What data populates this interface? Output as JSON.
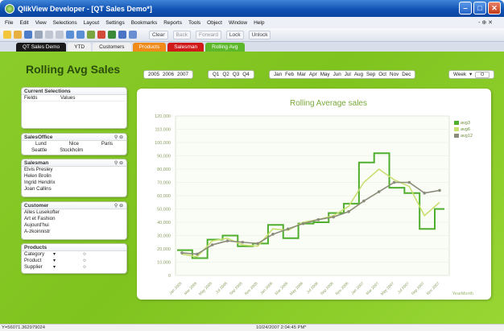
{
  "window": {
    "title": "QlikView Developer - [QT Sales Demo*]"
  },
  "menu": {
    "items": [
      "File",
      "Edit",
      "View",
      "Selections",
      "Layout",
      "Settings",
      "Bookmarks",
      "Reports",
      "Tools",
      "Object",
      "Window",
      "Help"
    ],
    "right_glyph": "- ⊕ ✕"
  },
  "toolbar": {
    "clear": "Clear",
    "back": "Back",
    "forward": "Forward",
    "lock": "Lock",
    "unlock": "Unlock"
  },
  "tabs": [
    {
      "label": "QT Sales Demo",
      "color": "#1a1a1a"
    },
    {
      "label": "YTD",
      "color": "#f0f0f0"
    },
    {
      "label": "Customers",
      "color": "#f0f0f0"
    },
    {
      "label": "Products",
      "color": "#f08a1a"
    },
    {
      "label": "Salesman",
      "color": "#d01a1a"
    },
    {
      "label": "Rolling Avg",
      "color": "#5cb82a"
    }
  ],
  "page": {
    "title": "Rolling Avg Sales"
  },
  "filters": {
    "years": [
      "2005",
      "2006",
      "2007"
    ],
    "quarters": [
      "Q1",
      "Q2",
      "Q3",
      "Q4"
    ],
    "months": [
      "Jan",
      "Feb",
      "Mar",
      "Apr",
      "May",
      "Jun",
      "Jul",
      "Aug",
      "Sep",
      "Oct",
      "Nov",
      "Dec"
    ],
    "week_label": "Week",
    "week_value": "O"
  },
  "current_selections": {
    "title": "Current Selections",
    "col_fields": "Fields",
    "col_values": "Values"
  },
  "sales_office": {
    "title": "SalesOffice",
    "items": [
      "Lund",
      "Nice",
      "Paris",
      "Seattle",
      "Stockholm"
    ]
  },
  "salesman": {
    "title": "Salesman",
    "items": [
      "Elvis Presley",
      "Helen Brolin",
      "Ingrid Hendrix",
      "Joan Callins"
    ]
  },
  "customer": {
    "title": "Customer",
    "items": [
      "Alles Lusekofter",
      "Art et Fashion",
      "Aujourd'hui",
      "A-zkoinnistr"
    ]
  },
  "products": {
    "title": "Products",
    "items": [
      "Category",
      "Product",
      "Supplier"
    ]
  },
  "chart_data": {
    "type": "line",
    "title": "Rolling Average sales",
    "xlabel": "YearMonth",
    "ylabel": "",
    "ylim": [
      0,
      120000
    ],
    "yticks": [
      "0",
      "10,000",
      "20,000",
      "30,000",
      "40,000",
      "50,000",
      "60,000",
      "70,000",
      "80,000",
      "90,000",
      "100,000",
      "110,000",
      "120,000"
    ],
    "x": [
      "Jan 2005",
      "Mar 2005",
      "May 2005",
      "Jul 2005",
      "Sep 2005",
      "Nov 2005",
      "Jan 2006",
      "Mar 2006",
      "May 2006",
      "Jul 2006",
      "Sep 2006",
      "Nov 2006",
      "Jan 2007",
      "Mar 2007",
      "May 2007",
      "Jul 2007",
      "Sep 2007",
      "Nov 2007"
    ],
    "legend_position": "top-right",
    "series": [
      {
        "name": "avg3",
        "color": "#4fae2e",
        "style": "step",
        "values": [
          19000,
          13000,
          27000,
          30000,
          22000,
          24000,
          38000,
          28000,
          39000,
          40000,
          47000,
          54000,
          85000,
          92000,
          66000,
          62000,
          35000,
          50000
        ]
      },
      {
        "name": "avg6",
        "color": "#c8e070",
        "style": "line",
        "values": [
          16000,
          14000,
          26000,
          28000,
          23000,
          22000,
          35000,
          34000,
          40000,
          42000,
          45000,
          52000,
          70000,
          80000,
          72000,
          67000,
          45000,
          55000
        ]
      },
      {
        "name": "avg12",
        "color": "#8c8c7a",
        "style": "line-dots",
        "values": [
          17000,
          16000,
          23000,
          26000,
          25000,
          24000,
          31000,
          35000,
          39000,
          42000,
          44000,
          48000,
          56000,
          63000,
          70000,
          70000,
          62000,
          64000
        ]
      }
    ]
  }
}
